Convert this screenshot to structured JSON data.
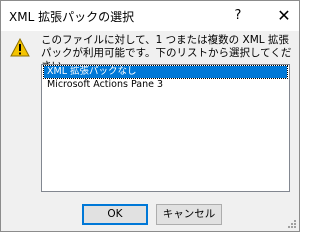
{
  "window": {
    "title": "XML 拡張パックの選択",
    "help_glyph": "?",
    "close_glyph": "✕"
  },
  "message": "このファイルに対して、1 つまたは複数の XML 拡張パックが利用可能です。下のリストから選択してください。",
  "list": {
    "items": [
      {
        "label": "XML 拡張パックなし",
        "selected": true
      },
      {
        "label": "Microsoft Actions Pane 3",
        "selected": false
      }
    ]
  },
  "buttons": {
    "ok": "OK",
    "cancel": "キャンセル"
  },
  "colors": {
    "selection": "#0078d7",
    "warning": "#f5c400"
  }
}
